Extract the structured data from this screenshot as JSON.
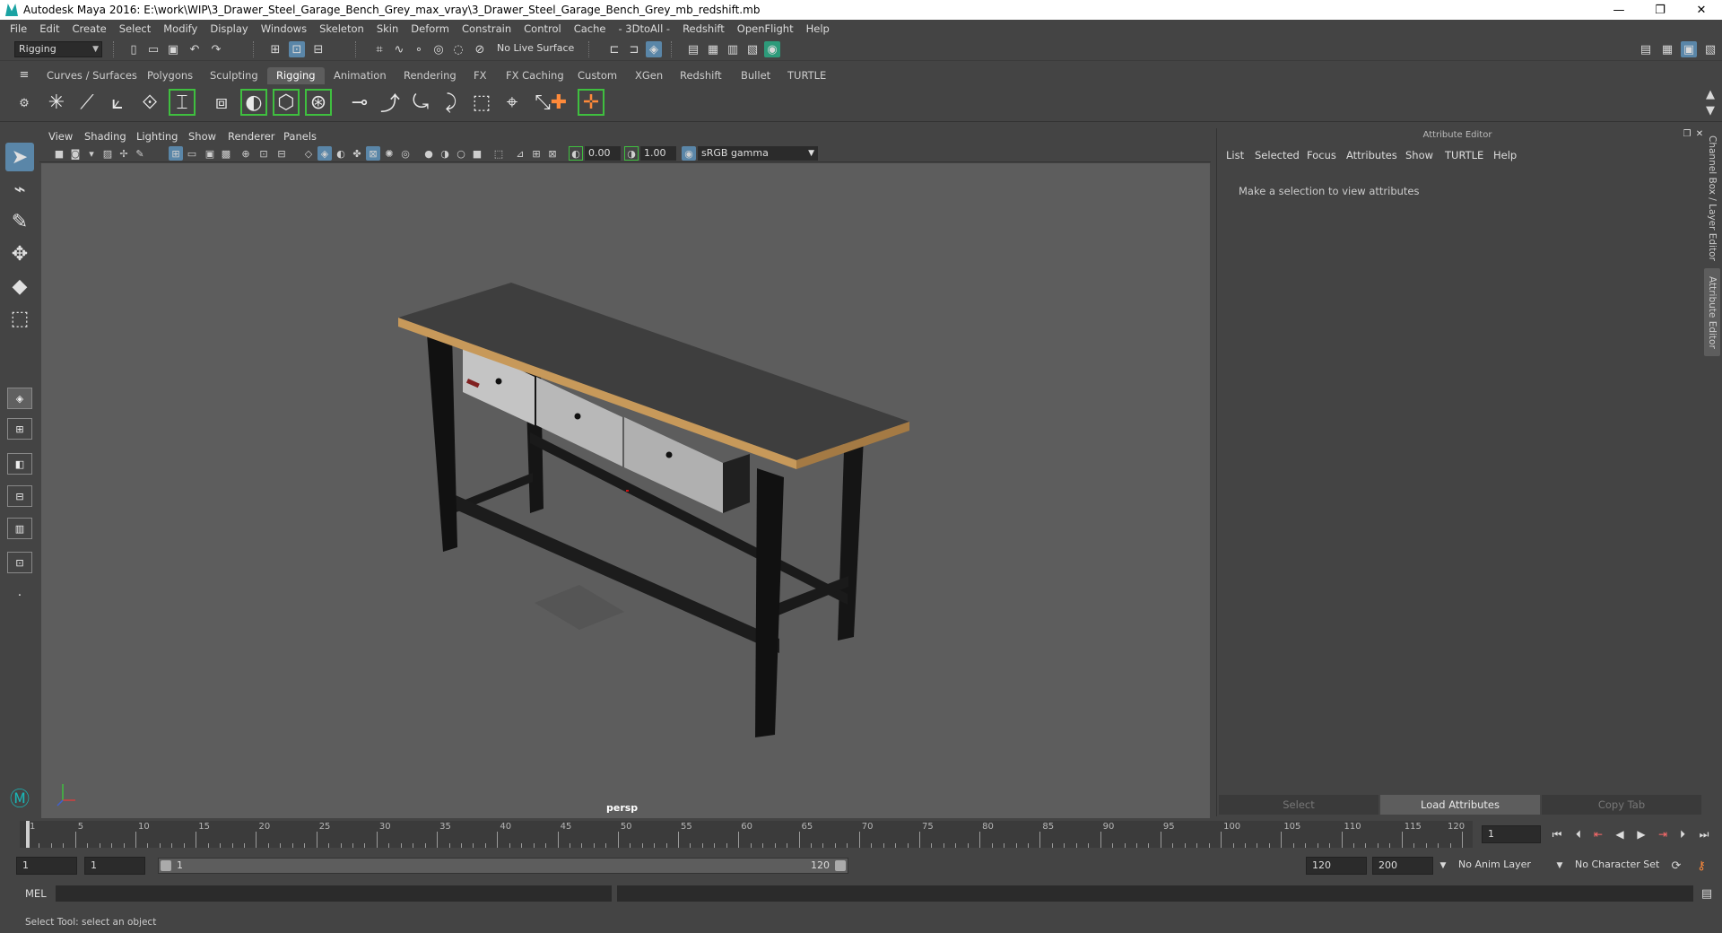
{
  "title": "Autodesk Maya 2016: E:\\work\\WIP\\3_Drawer_Steel_Garage_Bench_Grey_max_vray\\3_Drawer_Steel_Garage_Bench_Grey_mb_redshift.mb",
  "window_buttons": {
    "minimize": "—",
    "restore": "❐",
    "close": "✕"
  },
  "menubar": [
    "File",
    "Edit",
    "Create",
    "Select",
    "Modify",
    "Display",
    "Windows",
    "Skeleton",
    "Skin",
    "Deform",
    "Constrain",
    "Control",
    "Cache",
    "- 3DtoAll -",
    "Redshift",
    "OpenFlight",
    "Help"
  ],
  "status_line": {
    "mode": "Rigging",
    "live_surface": "No Live Surface"
  },
  "shelf_tabs": [
    "Curves / Surfaces",
    "Polygons",
    "Sculpting",
    "Rigging",
    "Animation",
    "Rendering",
    "FX",
    "FX Caching",
    "Custom",
    "XGen",
    "Redshift",
    "Bullet",
    "TURTLE"
  ],
  "active_shelf_tab": "Rigging",
  "viewport": {
    "menu": [
      "View",
      "Shading",
      "Lighting",
      "Show",
      "Renderer",
      "Panels"
    ],
    "exposure": "0.00",
    "gamma": "1.00",
    "color_space": "sRGB gamma",
    "camera_label": "persp",
    "colors": {
      "background": "#5d5d5d",
      "tabletop": "#3c3c3c",
      "table_edge": "#c79a5a",
      "legs": "#111111",
      "drawers": "#b9b9b9"
    }
  },
  "attribute_editor": {
    "header": "Attribute Editor",
    "menu": [
      "List",
      "Selected",
      "Focus",
      "Attributes",
      "Show",
      "TURTLE",
      "Help"
    ],
    "message": "Make a selection to view attributes",
    "buttons": {
      "select": "Select",
      "load": "Load Attributes",
      "copy": "Copy Tab"
    }
  },
  "side_tabs": {
    "channel_box": "Channel Box / Layer Editor",
    "attribute_editor": "Attribute Editor"
  },
  "timeline": {
    "labels": [
      "1",
      "5",
      "10",
      "15",
      "20",
      "25",
      "30",
      "35",
      "40",
      "45",
      "50",
      "55",
      "60",
      "65",
      "70",
      "75",
      "80",
      "85",
      "90",
      "95",
      "100",
      "105",
      "110",
      "115",
      "120"
    ],
    "current_frame": "1"
  },
  "range": {
    "start": "1",
    "playback_start": "1",
    "slider_start": "1",
    "slider_end": "120",
    "playback_end": "120",
    "end": "200",
    "anim_layer": "No Anim Layer",
    "character_set": "No Character Set"
  },
  "command_line": {
    "label": "MEL"
  },
  "help_line": "Select Tool: select an object"
}
